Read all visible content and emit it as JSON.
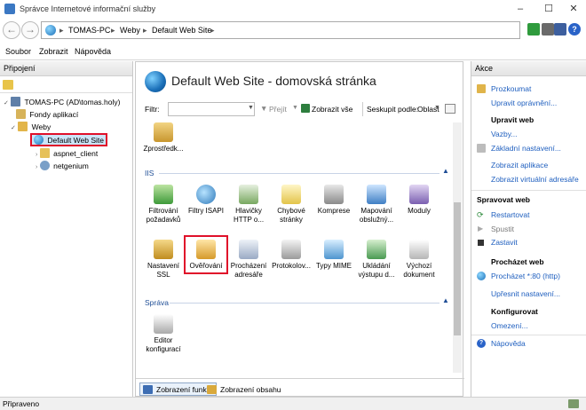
{
  "window": {
    "title": "Správce Internetové informační služby"
  },
  "address": {
    "crumbs": [
      "TOMAS-PC",
      "Weby",
      "Default Web Site"
    ]
  },
  "menu": {
    "items": [
      "Soubor",
      "Zobrazit",
      "Nápověda"
    ]
  },
  "connections": {
    "header": "Připojení",
    "tree": {
      "server": "TOMAS-PC (AD\\tomas.holy)",
      "app_pools": "Fondy aplikací",
      "sites": "Weby",
      "site": "Default Web Site",
      "children": [
        "aspnet_client",
        "netgenium"
      ]
    }
  },
  "center": {
    "title": "Default Web Site - domovská stránka",
    "filter_label": "Filtr:",
    "go_label": "Přejít",
    "show_all_label": "Zobrazit vše",
    "group_label": "Seskupit podle:",
    "group_value": "Oblast",
    "partial_item": "Zprostředk...",
    "sections": {
      "iis": {
        "title": "IIS",
        "row1": [
          "Filtrování požadavků",
          "Filtry ISAPI",
          "Hlavičky HTTP o...",
          "Chybové stránky",
          "Komprese",
          "Mapování obslužný...",
          "Moduly"
        ],
        "row2": [
          "Nastavení SSL",
          "Ověřování",
          "Procházení adresáře",
          "Protokolov...",
          "Typy MIME",
          "Ukládání výstupu d...",
          "Výchozí dokument"
        ]
      },
      "mgmt": {
        "title": "Správa",
        "items": [
          "Editor konfigurací"
        ]
      }
    },
    "tabs": {
      "features": "Zobrazení funkcí",
      "content": "Zobrazení obsahu"
    }
  },
  "actions": {
    "header": "Akce",
    "explore": "Prozkoumat",
    "edit_perms": "Upravit oprávnění...",
    "edit_site_head": "Upravit web",
    "bindings": "Vazby...",
    "basic_settings": "Základní nastavení...",
    "view_apps": "Zobrazit aplikace",
    "view_vdirs": "Zobrazit virtuální adresáře",
    "manage_head": "Spravovat web",
    "restart": "Restartovat",
    "start": "Spustit",
    "stop": "Zastavit",
    "browse_head": "Procházet web",
    "browse_80": "Procházet *:80 (http)",
    "advanced": "Upřesnit nastavení...",
    "configure_head": "Konfigurovat",
    "limits": "Omezení...",
    "help": "Nápověda"
  },
  "status": {
    "text": "Připraveno"
  },
  "colors": {
    "accent": "#1f5fbf",
    "highlight": "#e0102a",
    "selection": "#cce4f7"
  }
}
